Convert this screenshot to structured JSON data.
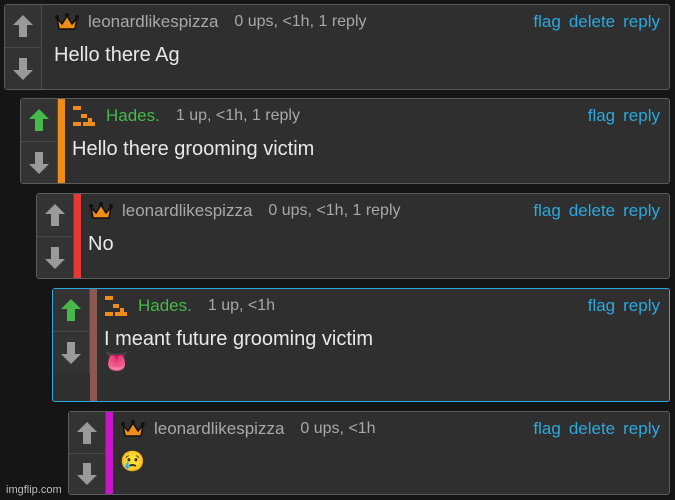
{
  "comments": [
    {
      "username": "leonardlikespizza",
      "meta": "0 ups, <1h, 1 reply",
      "text": "Hello there Ag",
      "actions": [
        "flag",
        "delete",
        "reply"
      ],
      "upvoted": false,
      "avatar_icon": "crown-icon",
      "accent_color": ""
    },
    {
      "username": "Hades.",
      "meta": "1 up, <1h, 1 reply",
      "text": "Hello there grooming victim",
      "actions": [
        "flag",
        "reply"
      ],
      "upvoted": true,
      "avatar_icon": "pixel-glyph-icon",
      "accent_color": "#f08c1a"
    },
    {
      "username": "leonardlikespizza",
      "meta": "0 ups, <1h, 1 reply",
      "text": "No",
      "actions": [
        "flag",
        "delete",
        "reply"
      ],
      "upvoted": false,
      "avatar_icon": "crown-icon",
      "accent_color": "#e53935"
    },
    {
      "username": "Hades.",
      "meta": "1 up, <1h",
      "text": "I meant future grooming victim",
      "emoji": "👅",
      "actions": [
        "flag",
        "reply"
      ],
      "upvoted": true,
      "avatar_icon": "pixel-glyph-icon",
      "accent_color": "#8a5a52"
    },
    {
      "username": "leonardlikespizza",
      "meta": "0 ups, <1h",
      "text": "😢",
      "actions": [
        "flag",
        "delete",
        "reply"
      ],
      "upvoted": false,
      "avatar_icon": "crown-icon",
      "accent_color": "#c817c8"
    }
  ],
  "colors": {
    "link": "#2aa9e0",
    "upvote_active": "#47b84c",
    "vote_inactive": "#9a9a9a",
    "crown": "#f08c1a"
  },
  "watermark": "imgflip.com"
}
